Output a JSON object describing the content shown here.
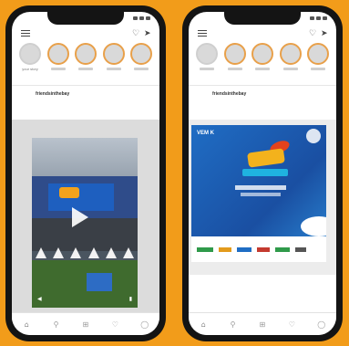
{
  "phones": [
    {
      "username": "friendsinthebay",
      "stories": [
        {
          "label": "your story"
        },
        {
          "label": ""
        },
        {
          "label": ""
        },
        {
          "label": ""
        },
        {
          "label": ""
        }
      ],
      "post_type": "video"
    },
    {
      "username": "friendsinthebay",
      "stories": [
        {
          "label": ""
        },
        {
          "label": ""
        },
        {
          "label": ""
        },
        {
          "label": ""
        },
        {
          "label": ""
        }
      ],
      "post_type": "image",
      "poster_brand": "VEM K"
    }
  ],
  "nav_icons": [
    "home-icon",
    "search-icon",
    "add-post-icon",
    "heart-icon",
    "profile-icon"
  ],
  "colors": {
    "background": "#f29c1a",
    "phone_frame": "#141414",
    "story_ring": "#e8a04a"
  }
}
